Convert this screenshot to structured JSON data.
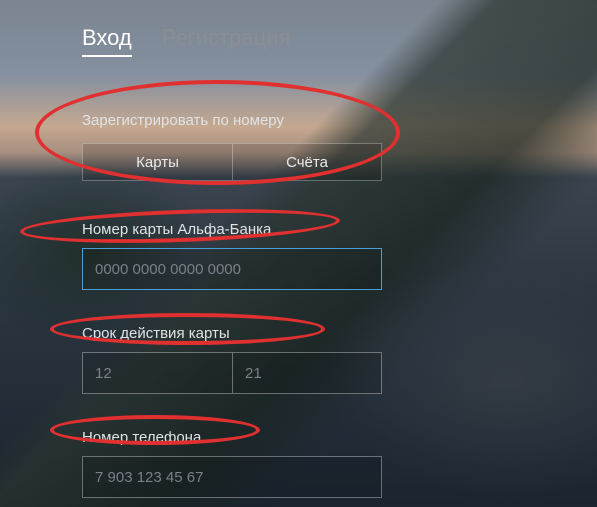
{
  "tabs": {
    "login": "Вход",
    "register": "Регистрация"
  },
  "register_by": {
    "label": "Зарегистрировать по номеру",
    "card": "Карты",
    "account": "Счёта"
  },
  "card_number": {
    "label": "Номер карты Альфа-Банка",
    "placeholder": "0000 0000 0000 0000"
  },
  "expiry": {
    "label": "Срок действия карты",
    "month_placeholder": "12",
    "year_placeholder": "21"
  },
  "phone": {
    "label": "Номер телефона",
    "placeholder": "7 903 123 45 67"
  }
}
